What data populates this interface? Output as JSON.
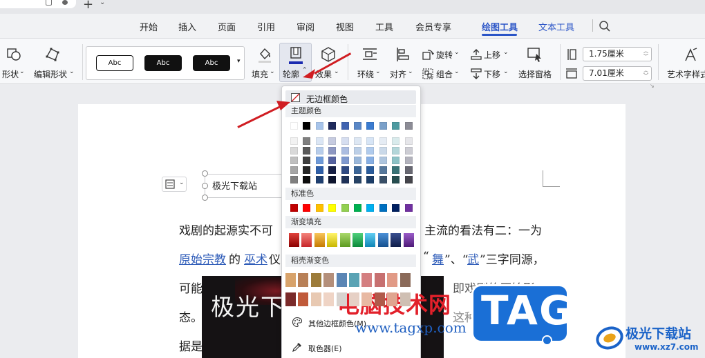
{
  "menu": {
    "items": [
      "开始",
      "插入",
      "页面",
      "引用",
      "审阅",
      "视图",
      "工具",
      "会员专享",
      "绘图工具",
      "文本工具"
    ],
    "active": "绘图工具"
  },
  "ribbon": {
    "shape_label": "形状",
    "edit_shape_label": "编辑形状",
    "style_samples": [
      "Abc",
      "Abc",
      "Abc"
    ],
    "fill_label": "填充",
    "outline_label": "轮廓",
    "effect_label": "效果",
    "wrap_label": "环绕",
    "align_label": "对齐",
    "rotate_label": "旋转",
    "group_label": "组合",
    "bring_forward_label": "上移",
    "send_backward_label": "下移",
    "select_pane_label": "选择窗格",
    "height_value": "1.75厘米",
    "width_value": "7.01厘米",
    "wordart_label": "艺术字样式"
  },
  "document": {
    "textbox_text": "极光下载站",
    "line1_a": "戏剧的起源实不可",
    "line1_b": "主流的看法有二：一为",
    "line2_link1": "原始宗教",
    "line2_de": "的",
    "line2_link2": "巫术",
    "line2_yi": "仪",
    "line2_q": "“",
    "line2_wu1": "舞",
    "line2_mid": "”、“",
    "line2_wu2": "武",
    "line2_rest": "”三字同源，",
    "line3_a": "可能",
    "line3_b": "即戏剧的原始形",
    "line4_a": "态。",
    "line4_b": "这种说法主要依",
    "line5_a": "据是",
    "image_text": "极光下"
  },
  "outline_menu": {
    "no_border": "无边框颜色",
    "theme_colors": "主题颜色",
    "standard_colors": "标准色",
    "gradient_fill": "渐变填充",
    "shell_gradient": "稻壳渐变色",
    "more_colors": "其他边框颜色(M)...",
    "eyedropper": "取色器(E)",
    "theme_top_row": [
      "#ffffff",
      "#000000",
      "#a7c4ea",
      "#1f2a5c",
      "#4063b0",
      "#5a87c6",
      "#3a7bd0",
      "#7aa0c9",
      "#4d9aa0",
      "#8c8c96"
    ],
    "theme_shades": [
      [
        "#f2f2f2",
        "#7f7f7f",
        "#dbe6f5",
        "#c6cbe0",
        "#d6def0",
        "#dde7f3",
        "#d7e5f6",
        "#e5ecf4",
        "#d9ebec",
        "#e6e6ea"
      ],
      [
        "#d9d9d9",
        "#595959",
        "#b7cdeb",
        "#8d97c2",
        "#acbde1",
        "#bccfe7",
        "#b0cbed",
        "#cad9e9",
        "#b3d6d9",
        "#cdcdd4"
      ],
      [
        "#bfbfbf",
        "#3f3f3f",
        "#6e9ad8",
        "#5562a0",
        "#7f99cf",
        "#9ab7da",
        "#87afe4",
        "#aec5de",
        "#8dc2c6",
        "#b3b3bd"
      ],
      [
        "#a6a6a6",
        "#262626",
        "#2e5fa8",
        "#161f45",
        "#2f4a84",
        "#3b6597",
        "#2a5c9c",
        "#55779b",
        "#397377",
        "#686872"
      ],
      [
        "#7f7f7f",
        "#0d0d0d",
        "#1f3f70",
        "#0e152e",
        "#1f3158",
        "#274365",
        "#1c3d68",
        "#394f67",
        "#264d4f",
        "#45454b"
      ]
    ],
    "standard_row": [
      "#c00000",
      "#ff0000",
      "#ffc000",
      "#ffff00",
      "#92d050",
      "#00b050",
      "#00b0f0",
      "#0070c0",
      "#002060",
      "#7030a0"
    ],
    "gradient_row": [
      [
        "#8b0000",
        "#e0413b"
      ],
      [
        "#c7262a",
        "#f3827a"
      ],
      [
        "#c67a00",
        "#f7c55a"
      ],
      [
        "#c9b700",
        "#fff36a"
      ],
      [
        "#5c9a20",
        "#a9d86b"
      ],
      [
        "#0b8a3a",
        "#4fcf7a"
      ],
      [
        "#0f86b6",
        "#61cdf2"
      ],
      [
        "#15508f",
        "#4a8fd6"
      ],
      [
        "#0f1d4a",
        "#3a4f8f"
      ],
      [
        "#4e1a78",
        "#9a5cc8"
      ]
    ],
    "shell_row1": [
      "#d8a36b",
      "#b88057",
      "#9c7b3a",
      "#b48f7a",
      "#5b86b5",
      "#5aa3b4",
      "#d47f80",
      "#c77070",
      "#e19a86",
      "#8a6a59"
    ],
    "shell_row2": [
      "#7a2a2a",
      "#c05a3a",
      "#e8c9b2",
      "#efd4c5",
      "#d8d3cf",
      "#e6d0c5",
      "#e8b9a3",
      "#b05a4a",
      "#e0a590",
      "#cfbfb3"
    ]
  },
  "watermarks": {
    "cn_site": "电脑技术网",
    "url": "www.tagxp.com",
    "tag": "TAG",
    "site_name": "极光下载站",
    "site_url": "www.xz7.com"
  },
  "colors": {
    "accent": "#2b55c7",
    "arrow": "#d01d22",
    "link": "#2d5bb8"
  }
}
